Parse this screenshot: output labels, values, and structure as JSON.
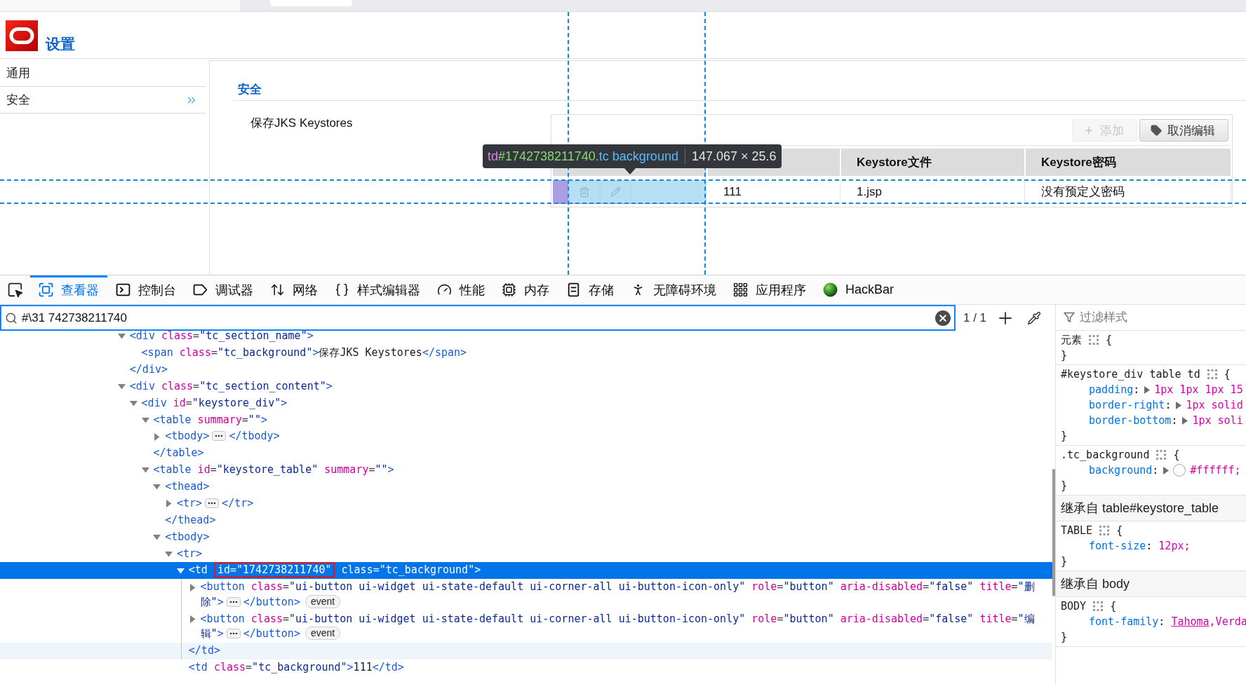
{
  "page": {
    "title": "设置",
    "nav": [
      {
        "label": "通用",
        "selected": false
      },
      {
        "label": "安全",
        "selected": true
      }
    ],
    "section": {
      "heading": "安全",
      "name": "保存JKS Keystores"
    },
    "keystore_table": {
      "buttons": [
        {
          "kind": "add",
          "label": "添加",
          "disabled": true
        },
        {
          "kind": "cancel",
          "label": "取消编辑",
          "disabled": false
        }
      ],
      "columns": [
        {
          "kind": "covered"
        },
        {
          "kind": "covered"
        },
        {
          "kind": "text",
          "label": "Keystore文件"
        },
        {
          "kind": "text",
          "label": "Keystore密码"
        }
      ],
      "rows": [
        {
          "cells": [
            {
              "kind": "actions",
              "highlighted": true,
              "buttons": [
                {
                  "kind": "delete"
                },
                {
                  "kind": "edit"
                }
              ]
            },
            {
              "kind": "text",
              "text": "111"
            },
            {
              "kind": "text",
              "text": "1.jsp"
            },
            {
              "kind": "text",
              "text": "没有预定义密码"
            }
          ]
        }
      ]
    },
    "inspector_tooltip": {
      "tag": "td",
      "id": "#1742738211740",
      "class": ".tc background",
      "size": "147.067 × 25.6"
    }
  },
  "devtools": {
    "tabs": [
      {
        "kind": "inspector",
        "label": "查看器",
        "selected": true
      },
      {
        "kind": "console",
        "label": "控制台",
        "selected": false
      },
      {
        "kind": "debugger",
        "label": "调试器",
        "selected": false
      },
      {
        "kind": "network",
        "label": "网络",
        "selected": false
      },
      {
        "kind": "style-editor",
        "label": "样式编辑器",
        "selected": false
      },
      {
        "kind": "performance",
        "label": "性能",
        "selected": false
      },
      {
        "kind": "memory",
        "label": "内存",
        "selected": false
      },
      {
        "kind": "storage",
        "label": "存储",
        "selected": false
      },
      {
        "kind": "accessibility",
        "label": "无障碍环境",
        "selected": false
      },
      {
        "kind": "application",
        "label": "应用程序",
        "selected": false
      },
      {
        "kind": "hackbar",
        "label": "HackBar",
        "selected": false
      }
    ],
    "search": {
      "value": "#\\31 742738211740",
      "count": "1 / 1"
    },
    "tree": [
      {
        "open": "<div class=\"tc_section_name\">",
        "close": "</div>",
        "expanded": true,
        "selected": false,
        "hovered": false,
        "children": [
          {
            "open": "<span class=\"tc_background\">",
            "text": "保存JKS Keystores",
            "close": "</span>",
            "selected": false,
            "hovered": false
          }
        ]
      },
      {
        "open": "<div class=\"tc_section_content\">",
        "expanded": true,
        "selected": false,
        "hovered": false,
        "children": [
          {
            "open": "<div id=\"keystore_div\">",
            "expanded": true,
            "selected": false,
            "hovered": false,
            "children": [
              {
                "open": "<table summary=\"\">",
                "close": "</table>",
                "expanded": true,
                "selected": false,
                "hovered": false,
                "children": [
                  {
                    "open": "<tbody>",
                    "close": "</tbody>",
                    "expanded": false,
                    "selected": false,
                    "hovered": false
                  }
                ]
              },
              {
                "open": "<table id=\"keystore_table\" summary=\"\">",
                "expanded": true,
                "selected": false,
                "hovered": false,
                "children": [
                  {
                    "open": "<thead>",
                    "close": "</thead>",
                    "expanded": true,
                    "selected": false,
                    "hovered": false,
                    "children": [
                      {
                        "open": "<tr>",
                        "close": "</tr>",
                        "expanded": false,
                        "selected": false,
                        "hovered": false
                      }
                    ]
                  },
                  {
                    "open": "<tbody>",
                    "expanded": true,
                    "selected": false,
                    "hovered": false,
                    "children": [
                      {
                        "open": "<tr>",
                        "expanded": true,
                        "selected": false,
                        "hovered": false,
                        "children": [
                          {
                            "open_parts": [
                              {
                                "text": "<td ",
                                "boxed": false
                              },
                              {
                                "text": "id=\"1742738211740\"",
                                "boxed": true
                              },
                              {
                                "text": " class=\"tc_background\">",
                                "boxed": false
                              }
                            ],
                            "close": "</td>",
                            "expanded": true,
                            "selected": true,
                            "hovered": true,
                            "children": [
                              {
                                "open": "<button class=\"ui-button ui-widget ui-state-default ui-corner-all ui-button-icon-only\" role=\"button\" aria-disabled=\"false\" title=\"删除\">",
                                "close": "</button>",
                                "badge": "event",
                                "expanded": false,
                                "selected": false,
                                "hovered": false
                              },
                              {
                                "open": "<button class=\"ui-button ui-widget ui-state-default ui-corner-all ui-button-icon-only\" role=\"button\" aria-disabled=\"false\" title=\"编辑\">",
                                "close": "</button>",
                                "badge": "event",
                                "expanded": false,
                                "selected": false,
                                "hovered": false
                              }
                            ]
                          },
                          {
                            "open": "<td class=\"tc_background\">",
                            "text": "111",
                            "close": "</td>",
                            "selected": false,
                            "hovered": false
                          }
                        ]
                      }
                    ]
                  }
                ]
              }
            ]
          }
        ]
      }
    ],
    "rules": {
      "filter_placeholder": "过滤样式",
      "items": [
        {
          "kind": "rule",
          "selector": "元素",
          "open": "{",
          "close": "}"
        },
        {
          "kind": "rule",
          "selector": "#keystore_div table td",
          "open": "{",
          "declarations": [
            {
              "name": "padding:",
              "expanded": false,
              "value": "1px 1px 1px 15"
            },
            {
              "name": "border-right:",
              "expanded": false,
              "value": "1px solid"
            },
            {
              "name": "border-bottom:",
              "expanded": false,
              "value": "1px soli"
            }
          ],
          "close": "}"
        },
        {
          "kind": "rule",
          "selector": ".tc_background",
          "open": "{",
          "declarations": [
            {
              "name": "background:",
              "expanded": false,
              "color": "#ffffff",
              "value": "#ffffff;"
            }
          ],
          "close": "}"
        },
        {
          "kind": "inherited",
          "label": "继承自 table#keystore_table"
        },
        {
          "kind": "rule",
          "selector": "TABLE",
          "open": "{",
          "declarations": [
            {
              "name": "font-size:",
              "value": "12px;"
            }
          ],
          "close": "}"
        },
        {
          "kind": "inherited",
          "label": "继承自 body"
        },
        {
          "kind": "rule",
          "selector": "BODY",
          "open": "{",
          "declarations": [
            {
              "name": "font-family:",
              "value_parts": [
                {
                  "text": "Tahoma",
                  "link": true
                },
                {
                  "text": ",Verda",
                  "link": false
                }
              ]
            }
          ],
          "close": "}"
        }
      ]
    }
  }
}
